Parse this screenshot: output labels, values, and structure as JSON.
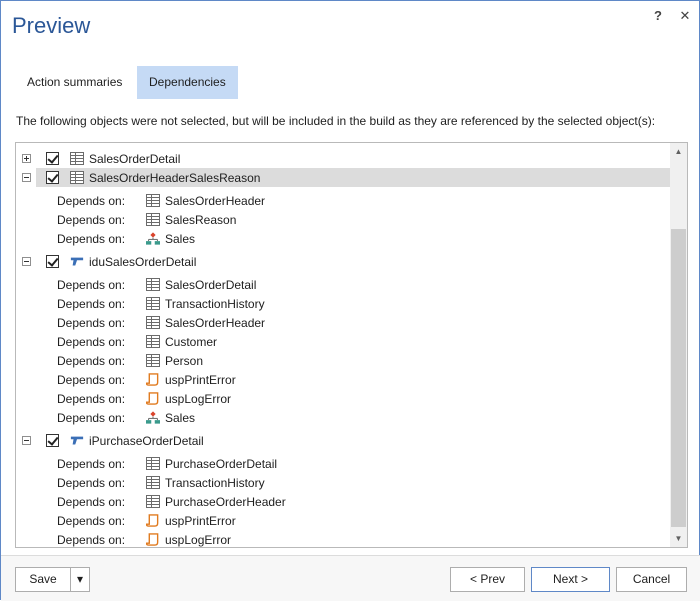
{
  "window": {
    "title": "Preview",
    "help": "?",
    "close": "✕"
  },
  "tabs": [
    {
      "label": "Action summaries",
      "active": false
    },
    {
      "label": "Dependencies",
      "active": true
    }
  ],
  "description": "The following objects were not selected, but will be included in the build as they are referenced by the selected object(s):",
  "depends_label": "Depends on:",
  "tree": {
    "row0": {
      "name": "SalesOrderDetail",
      "icon": "table-icon",
      "expanded": false
    },
    "row1": {
      "name": "SalesOrderHeaderSalesReason",
      "icon": "table-icon",
      "expanded": true,
      "selected": true,
      "deps": [
        {
          "name": "SalesOrderHeader",
          "icon": "table-icon"
        },
        {
          "name": "SalesReason",
          "icon": "table-icon"
        },
        {
          "name": "Sales",
          "icon": "schema-icon"
        }
      ]
    },
    "row2": {
      "name": "iduSalesOrderDetail",
      "icon": "trigger-icon",
      "expanded": true,
      "deps": [
        {
          "name": "SalesOrderDetail",
          "icon": "table-icon"
        },
        {
          "name": "TransactionHistory",
          "icon": "table-icon"
        },
        {
          "name": "SalesOrderHeader",
          "icon": "table-icon"
        },
        {
          "name": "Customer",
          "icon": "table-icon"
        },
        {
          "name": "Person",
          "icon": "table-icon"
        },
        {
          "name": "uspPrintError",
          "icon": "procedure-icon"
        },
        {
          "name": "uspLogError",
          "icon": "procedure-icon"
        },
        {
          "name": "Sales",
          "icon": "schema-icon"
        }
      ]
    },
    "row3": {
      "name": "iPurchaseOrderDetail",
      "icon": "trigger-icon",
      "expanded": true,
      "deps": [
        {
          "name": "PurchaseOrderDetail",
          "icon": "table-icon"
        },
        {
          "name": "TransactionHistory",
          "icon": "table-icon"
        },
        {
          "name": "PurchaseOrderHeader",
          "icon": "table-icon"
        },
        {
          "name": "uspPrintError",
          "icon": "procedure-icon"
        },
        {
          "name": "uspLogError",
          "icon": "procedure-icon"
        }
      ]
    }
  },
  "footer": {
    "save": "Save",
    "save_menu": "▾",
    "prev": "< Prev",
    "next": "Next >",
    "cancel": "Cancel"
  },
  "colors": {
    "accent": "#2b5797",
    "tab_active": "#c5daf5",
    "selection": "#dcdcdc",
    "procedure": "#e07a1f",
    "schema_top": "#d9442c",
    "schema_bottom": "#3a9a8c"
  }
}
